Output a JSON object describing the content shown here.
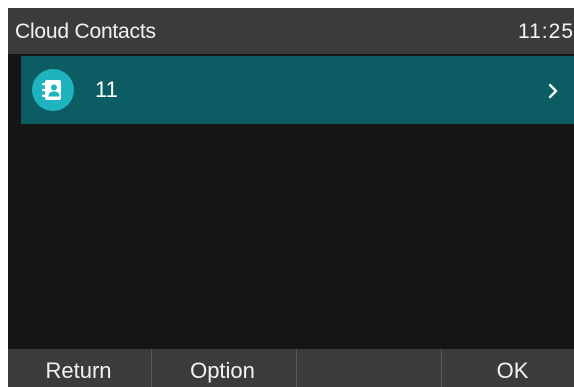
{
  "header": {
    "title": "Cloud Contacts",
    "time": "11:25"
  },
  "list": {
    "items": [
      {
        "label": "11",
        "icon": "contacts-book-icon",
        "selected": true
      }
    ]
  },
  "softkeys": [
    {
      "label": "Return"
    },
    {
      "label": "Option"
    },
    {
      "label": ""
    },
    {
      "label": "OK"
    }
  ],
  "colors": {
    "title_bar": "#3b3b3b",
    "background": "#151515",
    "selected_row": "#0c5d63",
    "icon_circle": "#1fb3bf"
  }
}
